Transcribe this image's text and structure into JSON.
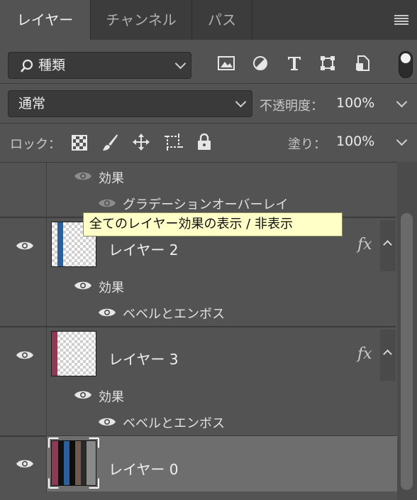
{
  "tabs": [
    {
      "label": "レイヤー",
      "active": true
    },
    {
      "label": "チャンネル",
      "active": false
    },
    {
      "label": "パス",
      "active": false
    }
  ],
  "filter": {
    "label": "種類"
  },
  "blend": {
    "mode": "通常",
    "opacity_label": "不透明度：",
    "opacity_value": "100%"
  },
  "lock": {
    "label": "ロック：",
    "fill_label": "塗り：",
    "fill_value": "100%"
  },
  "tooltip": "全てのレイヤー効果の表示 / 非表示",
  "layers": [
    {
      "effects_label": "効果",
      "effect": "グラデーションオーバーレイ"
    },
    {
      "name": "レイヤー 2",
      "fx": "fx",
      "effects_label": "効果",
      "effect": "ベベルとエンボス",
      "stripe": "#2d5f9a"
    },
    {
      "name": "レイヤー 3",
      "fx": "fx",
      "effects_label": "効果",
      "effect": "ベベルとエンボス",
      "stripe": "#8f3a52"
    },
    {
      "name": "レイヤー 0"
    }
  ],
  "colors": {
    "panel": "#535353",
    "tabbar": "#3c3c3c",
    "selected": "#6e6e6e",
    "tooltip_bg": "#ffffc7"
  }
}
